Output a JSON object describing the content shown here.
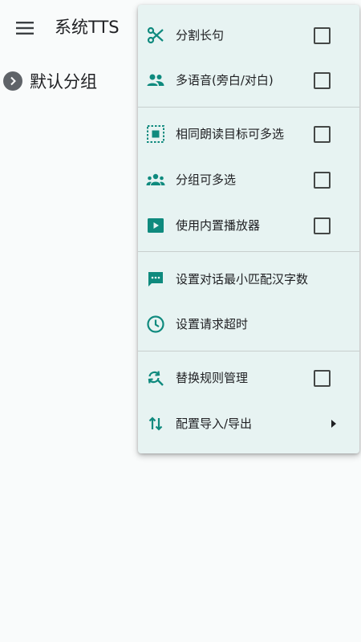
{
  "app_bar": {
    "title": "系统TTS",
    "menu_icon": "hamburger-menu-icon"
  },
  "group": {
    "label": "默认分组",
    "icon": "chevron-right-circle-icon"
  },
  "colors": {
    "accent": "#0f8a7e",
    "menu_background": "#e7f3f2",
    "page_background": "#f9fbfb"
  },
  "menu": {
    "items": [
      {
        "label": "分割长句",
        "icon": "scissors-icon",
        "checkbox": true,
        "checked": false
      },
      {
        "label": "多语音(旁白/对白)",
        "icon": "people-icon",
        "checkbox": true,
        "checked": false
      },
      {
        "label": "相同朗读目标可多选",
        "icon": "select-all-icon",
        "checkbox": true,
        "checked": false
      },
      {
        "label": "分组可多选",
        "icon": "groups-icon",
        "checkbox": true,
        "checked": false
      },
      {
        "label": "使用内置播放器",
        "icon": "play-box-icon",
        "checkbox": true,
        "checked": false
      },
      {
        "label": "设置对话最小匹配汉字数",
        "icon": "chat-bubble-icon"
      },
      {
        "label": "设置请求超时",
        "icon": "clock-icon"
      },
      {
        "label": "替换规则管理",
        "icon": "find-replace-icon",
        "checkbox": true,
        "checked": false
      },
      {
        "label": "配置导入/导出",
        "icon": "import-export-icon",
        "submenu": true
      }
    ]
  }
}
